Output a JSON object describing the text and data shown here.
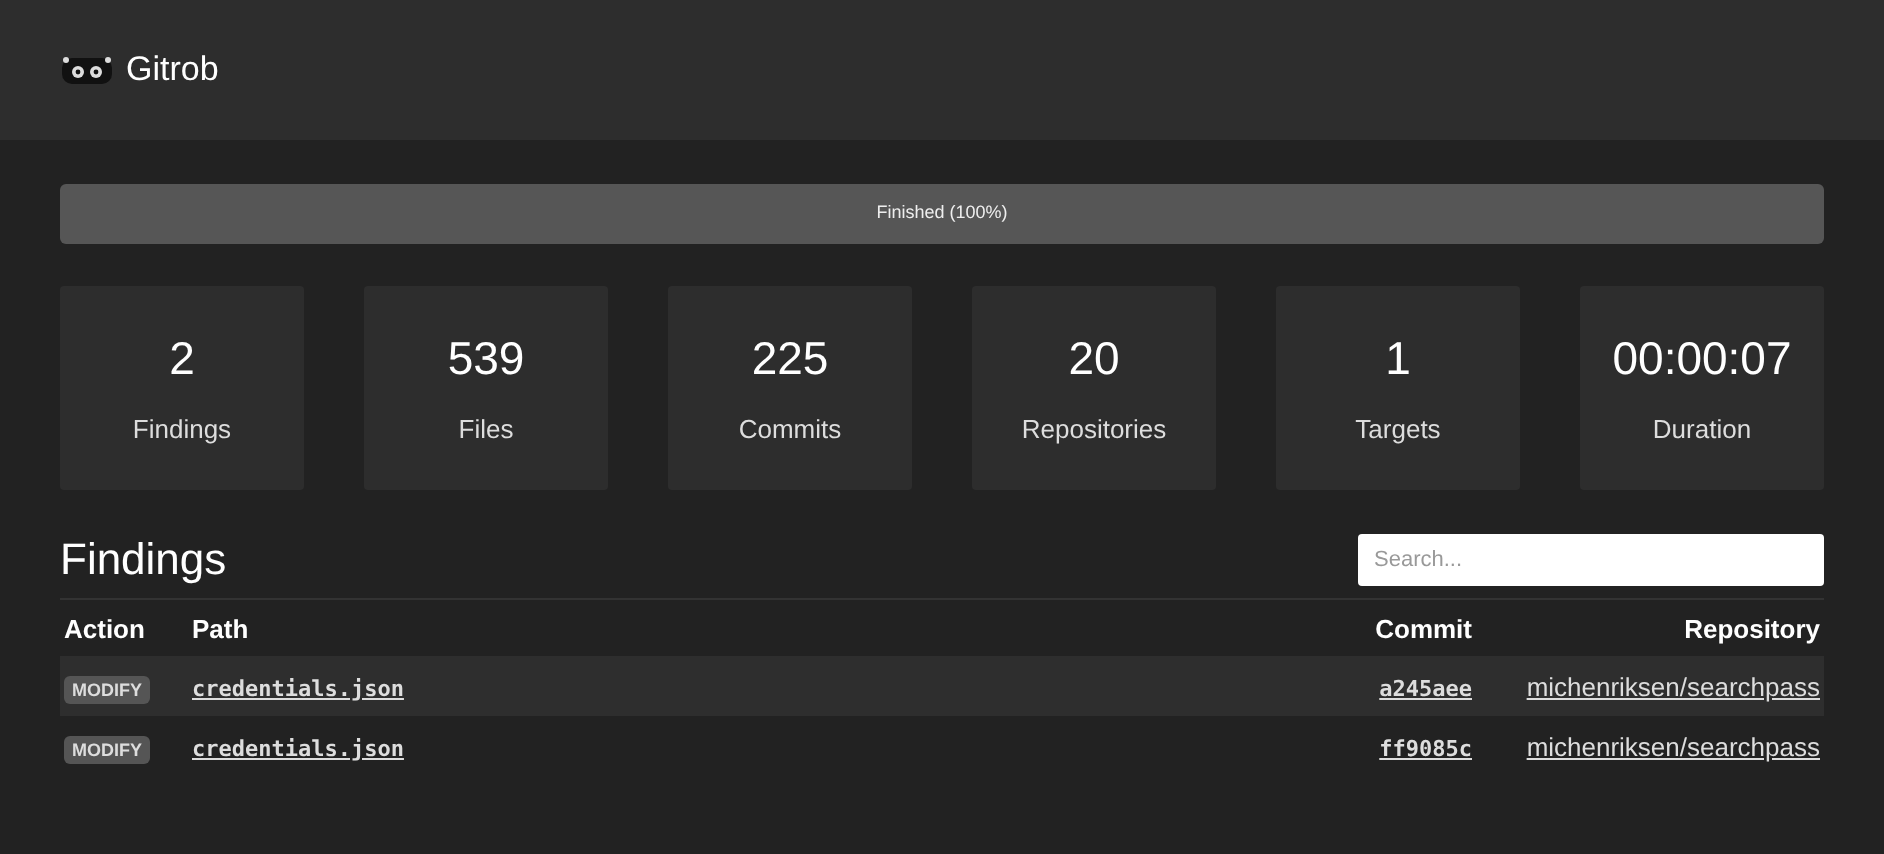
{
  "navbar": {
    "brand": "Gitrob"
  },
  "progress": {
    "label": "Finished (100%)",
    "level": 1
  },
  "stats": [
    {
      "value": "2",
      "label": "Findings"
    },
    {
      "value": "539",
      "label": "Files"
    },
    {
      "value": "225",
      "label": "Commits"
    },
    {
      "value": "20",
      "label": "Repositories"
    },
    {
      "value": "1",
      "label": "Targets"
    },
    {
      "value": "00:00:07",
      "label": "Duration"
    }
  ],
  "findings": {
    "title": "Findings",
    "search": {
      "placeholder": "Search..."
    },
    "columns": [
      "Action",
      "Path",
      "Commit",
      "Repository"
    ],
    "rows": [
      {
        "action": "MODIFY",
        "path": "credentials.json",
        "commit": "a245aee",
        "repository": "michenriksen/searchpass"
      },
      {
        "action": "MODIFY",
        "path": "credentials.json",
        "commit": "ff9085c",
        "repository": "michenriksen/searchpass"
      }
    ]
  }
}
